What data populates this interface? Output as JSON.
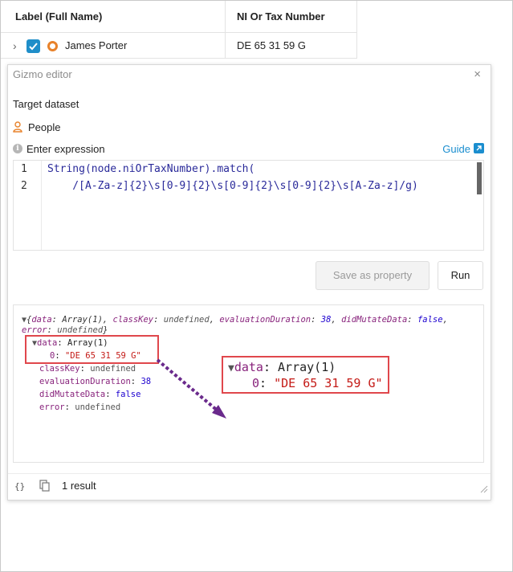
{
  "table": {
    "headers": [
      "Label (Full Name)",
      "NI Or Tax Number"
    ],
    "row": {
      "name": "James Porter",
      "tax": "DE 65 31 59 G"
    }
  },
  "gizmo": {
    "title": "Gizmo editor",
    "close": "×",
    "target_label": "Target dataset",
    "dataset": "People",
    "expression_label": "Enter expression",
    "guide": "Guide",
    "lines": [
      {
        "num": "1",
        "code": "String(node.niOrTaxNumber).match("
      },
      {
        "num": "2",
        "code": "    /[A-Za-z]{2}\\s[0-9]{2}\\s[0-9]{2}\\s[0-9]{2}\\s[A-Za-z]/g)"
      }
    ],
    "save_button": "Save as property",
    "run_button": "Run",
    "output": {
      "summary_head": "{",
      "summary_data_key": "data",
      "summary_data_val": "Array(1)",
      "summary_class_key": "classKey",
      "summary_class_val": "undefined",
      "summary_eval_key": "evaluationDuration",
      "summary_eval_val": "38",
      "summary_mut_key": "didMutateData",
      "summary_mut_val": "false",
      "summary_err_key": "error",
      "summary_err_val": "undefined",
      "data_key": "data",
      "data_val": "Array(1)",
      "item_index": "0",
      "item_value": "\"DE 65 31 59 G\"",
      "class_key": "classKey",
      "class_val": "undefined",
      "eval_key": "evaluationDuration",
      "eval_val": "38",
      "mut_key": "didMutateData",
      "mut_val": "false",
      "err_key": "error",
      "err_val": "undefined"
    },
    "zoom": {
      "data_key": "data",
      "data_val": "Array(1)",
      "item_index": "0",
      "item_value": "\"DE 65 31 59 G\""
    },
    "result_text": "1 result",
    "icons": [
      "chevron-right-icon",
      "checkbox-checked-icon",
      "node-ring-icon",
      "person-icon",
      "info-icon",
      "external-link-icon",
      "braces-icon",
      "copy-icon",
      "resize-icon",
      "close-icon"
    ],
    "colors": {
      "accent": "#1b8ecf",
      "checkbox": "#1f8ec9",
      "node": "#e8822a",
      "highlight": "#e0474c",
      "arrow": "#6a2a8c"
    }
  }
}
